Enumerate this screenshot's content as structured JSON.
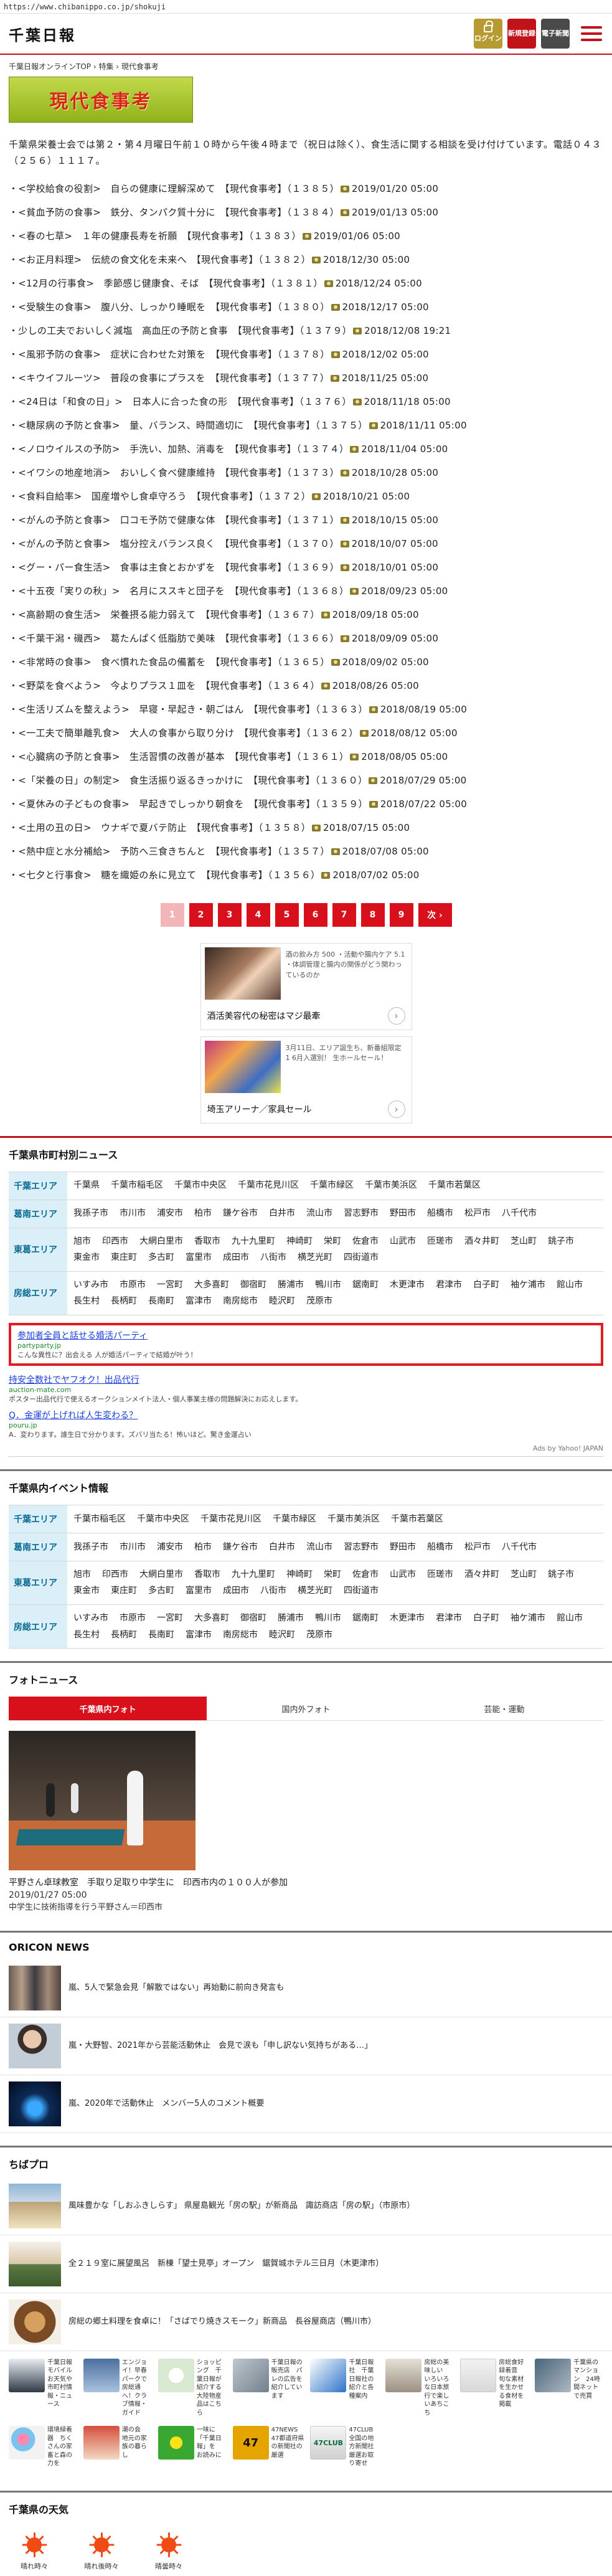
{
  "url": "https://www.chibanippo.co.jp/shokuji",
  "header": {
    "logo": "千葉日報",
    "login_label": "ログイン",
    "register_label": "新規登録",
    "paper_label": "電子新聞"
  },
  "breadcrumb": "千葉日報オンラインTOP › 特集 › 現代食事考",
  "page_title": "現代食事考",
  "intro": "千葉県栄養士会では第２・第４月曜日午前１０時から午後４時まで（祝日は除く）、食生活に関する相談を受け付けています。電話０４３（２５６）１１１７。",
  "articles": [
    {
      "text": "・<学校給食の役割>　自らの健康に理解深めて　【現代食事考】（１３８５）",
      "date": "2019/01/20 05:00"
    },
    {
      "text": "・<貧血予防の食事>　鉄分、タンパク質十分に　【現代食事考】（１３８４）",
      "date": "2019/01/13 05:00"
    },
    {
      "text": "・<春の七草>　１年の健康長寿を祈願　【現代食事考】（１３８３）",
      "date": "2019/01/06 05:00"
    },
    {
      "text": "・<お正月料理>　伝統の食文化を未来へ　【現代食事考】（１３８２）",
      "date": "2018/12/30 05:00"
    },
    {
      "text": "・<12月の行事食>　季節感じ健康食、そば　【現代食事考】（１３８１）",
      "date": "2018/12/24 05:00"
    },
    {
      "text": "・<受験生の食事>　腹八分、しっかり睡眠を　【現代食事考】（１３８０）",
      "date": "2018/12/17 05:00"
    },
    {
      "text": "・少しの工夫でおいしく減塩　高血圧の予防と食事　【現代食事考】（１３７９）",
      "date": "2018/12/08 19:21"
    },
    {
      "text": "・<風邪予防の食事>　症状に合わせた対策を　【現代食事考】（１３７８）",
      "date": "2018/12/02 05:00"
    },
    {
      "text": "・<キウイフルーツ>　普段の食事にプラスを　【現代食事考】（１３７７）",
      "date": "2018/11/25 05:00"
    },
    {
      "text": "・<24日は「和食の日」>　日本人に合った食の形　【現代食事考】（１３７６）",
      "date": "2018/11/18 05:00"
    },
    {
      "text": "・<糖尿病の予防と食事>　量、バランス、時間適切に　【現代食事考】（１３７５）",
      "date": "2018/11/11 05:00"
    },
    {
      "text": "・<ノロウイルスの予防>　手洗い、加熱、消毒を　【現代食事考】（１３７４）",
      "date": "2018/11/04 05:00"
    },
    {
      "text": "・<イワシの地産地消>　おいしく食べ健康維持　【現代食事考】（１３７３）",
      "date": "2018/10/28 05:00"
    },
    {
      "text": "・<食料自給率>　国産増やし食卓守ろう　【現代食事考】（１３７２）",
      "date": "2018/10/21 05:00"
    },
    {
      "text": "・<がんの予防と食事>　口コモ予防で健康な体　【現代食事考】（１３７１）",
      "date": "2018/10/15 05:00"
    },
    {
      "text": "・<がんの予防と食事>　塩分控えバランス良く　【現代食事考】（１３７０）",
      "date": "2018/10/07 05:00"
    },
    {
      "text": "・<グー・パー食生活>　食事は主食とおかずを　【現代食事考】（１３６９）",
      "date": "2018/10/01 05:00"
    },
    {
      "text": "・<十五夜「実りの秋」>　名月にススキと団子を　【現代食事考】（１３６８）",
      "date": "2018/09/23 05:00"
    },
    {
      "text": "・<高齢期の食生活>　栄養摂る能力弱えて　【現代食事考】（１３６７）",
      "date": "2018/09/18 05:00"
    },
    {
      "text": "・<千葉干潟・磯西>　葛たんぱく低脂肪で美味　【現代食事考】（１３６６）",
      "date": "2018/09/09 05:00"
    },
    {
      "text": "・<非常時の食事>　食べ慣れた食品の備蓄を　【現代食事考】（１３６５）",
      "date": "2018/09/02 05:00"
    },
    {
      "text": "・<野菜を食べよう>　今よりプラス１皿を　【現代食事考】（１３６４）",
      "date": "2018/08/26 05:00"
    },
    {
      "text": "・<生活リズムを整えよう>　早寝・早起き・朝ごはん　【現代食事考】（１３６３）",
      "date": "2018/08/19 05:00"
    },
    {
      "text": "・<一工夫で簡単離乳食>　大人の食事から取り分け　【現代食事考】（１３６２）",
      "date": "2018/08/12 05:00"
    },
    {
      "text": "・<心臓病の予防と食事>　生活習慣の改善が基本　【現代食事考】（１３６１）",
      "date": "2018/08/05 05:00"
    },
    {
      "text": "・<「栄養の日」の制定>　食生活振り返るきっかけに　【現代食事考】（１３６０）",
      "date": "2018/07/29 05:00"
    },
    {
      "text": "・<夏休みの子どもの食事>　早起きでしっかり朝食を　【現代食事考】（１３５９）",
      "date": "2018/07/22 05:00"
    },
    {
      "text": "・<土用の丑の日>　ウナギで夏バテ防止　【現代食事考】（１３５８）",
      "date": "2018/07/15 05:00"
    },
    {
      "text": "・<熱中症と水分補給>　予防へ三食きちんと　【現代食事考】（１３５７）",
      "date": "2018/07/08 05:00"
    },
    {
      "text": "・<七夕と行事食>　糖を織姫の糸に見立て　【現代食事考】（１３５６）",
      "date": "2018/07/02 05:00"
    }
  ],
  "pagination": [
    "1",
    "2",
    "3",
    "4",
    "5",
    "6",
    "7",
    "8",
    "9"
  ],
  "pagination_next": "次 ›",
  "ads": [
    {
      "text": "酒の飲み方 500 ・活動や腸内ケア 5.1 ・体調管理と腸内の関係がどう関わっているのか",
      "title": "酒活美容代の秘密はマジ最牽"
    },
    {
      "text": "3月11日、エリア誕生ち、新番組限定 1 6月入選別！ 生ホールセール！",
      "title": "埼玉アリーナ／家具セール"
    }
  ],
  "muni_news": {
    "title": "千葉県市町村別ニュース",
    "areas": [
      {
        "label": "千葉エリア",
        "cities": [
          "千葉県",
          "千葉市稲毛区",
          "千葉市中央区",
          "千葉市花見川区",
          "千葉市緑区",
          "千葉市美浜区",
          "千葉市若葉区"
        ]
      },
      {
        "label": "葛南エリア",
        "cities": [
          "我孫子市",
          "市川市",
          "浦安市",
          "柏市",
          "鎌ケ谷市",
          "白井市",
          "流山市",
          "習志野市",
          "野田市",
          "船橋市",
          "松戸市",
          "八千代市"
        ]
      },
      {
        "label": "東葛エリア",
        "cities": [
          "旭市",
          "印西市",
          "大網白里市",
          "香取市",
          "九十九里町",
          "神崎町",
          "栄町",
          "佐倉市",
          "山武市",
          "匝瑳市",
          "酒々井町",
          "芝山町",
          "銚子市",
          "東金市",
          "東庄町",
          "多古町",
          "富里市",
          "成田市",
          "八街市",
          "横芝光町",
          "四街道市"
        ]
      },
      {
        "label": "房総エリア",
        "cities": [
          "いすみ市",
          "市原市",
          "一宮町",
          "大多喜町",
          "御宿町",
          "勝浦市",
          "鴨川市",
          "鋸南町",
          "木更津市",
          "君津市",
          "白子町",
          "袖ケ浦市",
          "館山市",
          "長生村",
          "長柄町",
          "長南町",
          "富津市",
          "南房総市",
          "睦沢町",
          "茂原市"
        ]
      }
    ]
  },
  "yahoo_ads": [
    {
      "title": "参加者全員と話せる婚活パーティ",
      "url": "partyparty.jp",
      "desc": "こんな異性に？出会える 人が婚活パーティで結婚が叶う！"
    },
    {
      "title": "持安全数社でヤフオク！出品代行",
      "url": "auction-mate.com",
      "desc": "ポスター出品代行で使えるオークションメイト法人・個人事業主様の問題解決にお応えします。"
    },
    {
      "title": "Q．金運が上げれば人生変わる？",
      "url": "pouru.jp",
      "desc": "A．変わります。誰生日で分かります。ズバリ当たる！怖いほど。驚き金運占い"
    }
  ],
  "yahoo_credit": "Ads by Yahoo! JAPAN",
  "events": {
    "title": "千葉県内イベント情報",
    "areas": [
      {
        "label": "千葉エリア",
        "cities": [
          "千葉市稲毛区",
          "千葉市中央区",
          "千葉市花見川区",
          "千葉市緑区",
          "千葉市美浜区",
          "千葉市若葉区"
        ]
      },
      {
        "label": "葛南エリア",
        "cities": [
          "我孫子市",
          "市川市",
          "浦安市",
          "柏市",
          "鎌ケ谷市",
          "白井市",
          "流山市",
          "習志野市",
          "野田市",
          "船橋市",
          "松戸市",
          "八千代市"
        ]
      },
      {
        "label": "東葛エリア",
        "cities": [
          "旭市",
          "印西市",
          "大網白里市",
          "香取市",
          "九十九里町",
          "神崎町",
          "栄町",
          "佐倉市",
          "山武市",
          "匝瑳市",
          "酒々井町",
          "芝山町",
          "銚子市",
          "東金市",
          "東庄町",
          "多古町",
          "富里市",
          "成田市",
          "八街市",
          "横芝光町",
          "四街道市"
        ]
      },
      {
        "label": "房総エリア",
        "cities": [
          "いすみ市",
          "市原市",
          "一宮町",
          "大多喜町",
          "御宿町",
          "勝浦市",
          "鴨川市",
          "鋸南町",
          "木更津市",
          "君津市",
          "白子町",
          "袖ケ浦市",
          "館山市",
          "長生村",
          "長柄町",
          "長南町",
          "富津市",
          "南房総市",
          "睦沢町",
          "茂原市"
        ]
      }
    ]
  },
  "photo_news": {
    "title": "フォトニュース",
    "tabs": [
      "千葉県内フォト",
      "国内外フォト",
      "芸能・運動"
    ],
    "caption": "平野さん卓球教室　手取り足取り中学生に　印西市内の１００人が参加",
    "date": "2019/01/27 05:00",
    "sub": "中学生に技術指導を行う平野さん＝印西市"
  },
  "oricon": {
    "title": "ORICON NEWS",
    "items": [
      "嵐、5人で緊急会見「解散ではない」再始動に前向き発言も",
      "嵐・大野智、2021年から芸能活動休止　会見で涙も「申し訳ない気持ちがある…」",
      "嵐、2020年で活動休止　メンバー5人のコメント概要"
    ]
  },
  "chibapuro": {
    "title": "ちばプロ",
    "items": [
      "風味豊かな「しおふきしらす」 県屋島観光「房の駅」が新商品　諏訪商店「房の駅」（市原市）",
      "全２１９室に展望風呂　新棟「望士見亭」オープン　鋸賀城ホテル三日月（木更津市）",
      "房総の郷土料理を食卓に！「さばでり焼きスモーク」新商品　長谷屋商店（鴨川市）"
    ]
  },
  "apps": [
    {
      "label": "千葉日報モバイル　お天気や市町村情報・ニュース"
    },
    {
      "label": "エンジョイ！早春パークで房総通へ！クラブ情報・ガイド"
    },
    {
      "label": "ショッピング　千葉日報が紹介する大陸物産品はこちら"
    },
    {
      "label": "千葉日報の販売店　パレの広告を紹介しています"
    },
    {
      "label": "千葉日報社　千葉日報社の紹介と各種案内"
    },
    {
      "label": "房総の美味しい　いろいろな日本旅行で楽しいあちこち"
    },
    {
      "label": "房総食好録着音　旬な素材を生かせる食材を掲載"
    },
    {
      "label": "千葉県のマンション　24時間ネットで売買"
    },
    {
      "label": "環境緑着器　ちくさんの家畜と森の力を"
    },
    {
      "label": "潮の会　地元の家族の暮らし"
    },
    {
      "label": "一味に「千葉日報」を　お読みに"
    },
    {
      "label": "47NEWS　47都道府県の新聞社の厳選"
    },
    {
      "label": "47CLUB　全国の地方新聞社厳選お取り寄せ"
    }
  ],
  "app_icon_text": {
    "n": "47",
    "o": "47CLUB"
  },
  "weather": {
    "title": "千葉県の天気",
    "labels": [
      "晴れ時々",
      "晴れ後時々",
      "晴曇時々"
    ]
  }
}
